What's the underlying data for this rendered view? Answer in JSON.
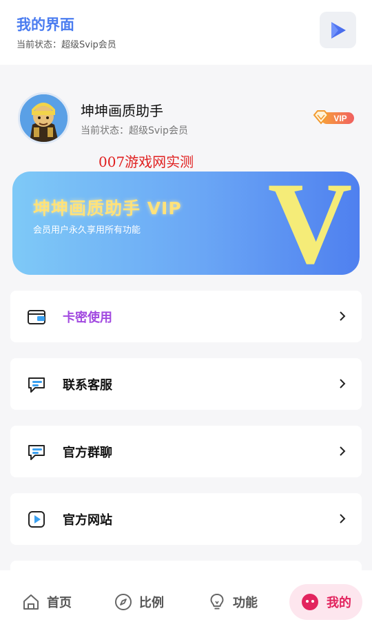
{
  "header": {
    "title": "我的界面",
    "status": "当前状态：超级Svip会员",
    "action_icon": "play-triangle-icon"
  },
  "profile": {
    "name": "坤坤画质助手",
    "status": "当前状态：超级Svip会员",
    "badge": "VIP",
    "watermark": "007游戏网实测"
  },
  "banner": {
    "title": "坤坤画质助手 VIP",
    "subtitle": "会员用户永久享用所有功能",
    "big_letter": "V"
  },
  "menu": [
    {
      "label": "卡密使用",
      "icon": "wallet-icon"
    },
    {
      "label": "联系客服",
      "icon": "chat-icon"
    },
    {
      "label": "官方群聊",
      "icon": "chat-icon"
    },
    {
      "label": "官方网站",
      "icon": "play-icon"
    }
  ],
  "nav": [
    {
      "label": "首页",
      "icon": "home-icon"
    },
    {
      "label": "比例",
      "icon": "compass-icon"
    },
    {
      "label": "功能",
      "icon": "bulb-icon"
    },
    {
      "label": "我的",
      "icon": "face-icon",
      "active": true
    }
  ],
  "colors": {
    "accent_blue": "#4a7cf0",
    "accent_purple": "#a24ae0",
    "active_pink": "#e2245e",
    "vip_yellow": "#ffe27a"
  }
}
